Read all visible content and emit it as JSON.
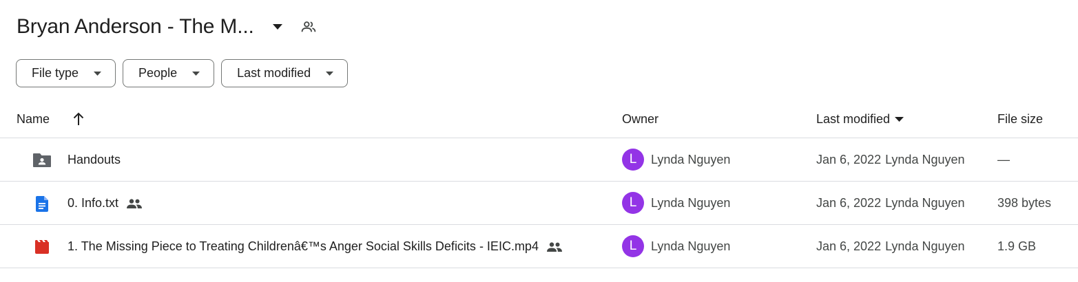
{
  "header": {
    "title": "Bryan Anderson - The M...",
    "caret_icon": "arrow-drop-down-icon",
    "shared_icon": "people-icon"
  },
  "filters": [
    {
      "label": "File type",
      "icon": "arrow-drop-down-icon"
    },
    {
      "label": "People",
      "icon": "arrow-drop-down-icon"
    },
    {
      "label": "Last modified",
      "icon": "arrow-drop-down-icon"
    }
  ],
  "columns": {
    "name": "Name",
    "name_sort_icon": "arrow-up-icon",
    "owner": "Owner",
    "modified": "Last modified",
    "modified_sort_icon": "arrow-drop-down-icon",
    "size": "File size"
  },
  "rows": [
    {
      "icon": "shared-folder-icon",
      "name": "Handouts",
      "shared": false,
      "owner_initial": "L",
      "owner": "Lynda Nguyen",
      "modified_date": "Jan 6, 2022",
      "modified_by": "Lynda Nguyen",
      "size": "—"
    },
    {
      "icon": "google-doc-icon",
      "name": "0. Info.txt",
      "shared": true,
      "owner_initial": "L",
      "owner": "Lynda Nguyen",
      "modified_date": "Jan 6, 2022",
      "modified_by": "Lynda Nguyen",
      "size": "398 bytes"
    },
    {
      "icon": "video-file-icon",
      "name": "1. The Missing Piece to Treating Childrenâ€™s Anger  Social Skills Deficits - IEIC.mp4",
      "shared": true,
      "owner_initial": "L",
      "owner": "Lynda Nguyen",
      "modified_date": "Jan 6, 2022",
      "modified_by": "Lynda Nguyen",
      "size": "1.9 GB"
    }
  ],
  "colors": {
    "avatar": "#9334e6",
    "doc_icon": "#1a73e8",
    "video_icon": "#d93025",
    "folder_icon": "#5f6368",
    "border": "#dadce0"
  }
}
